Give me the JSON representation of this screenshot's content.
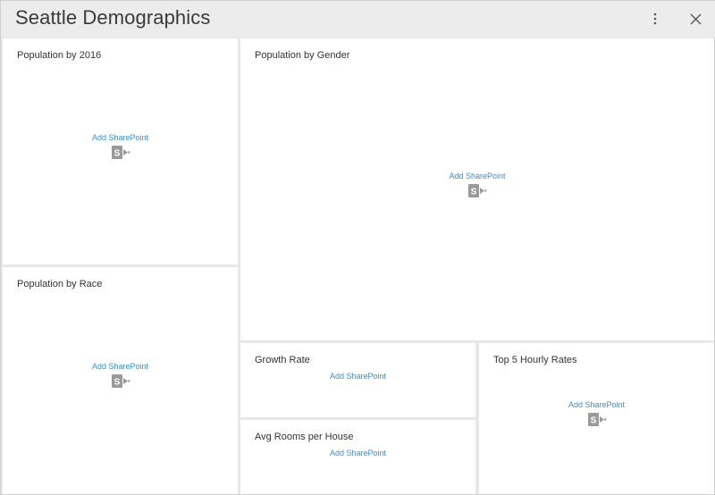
{
  "window": {
    "title": "Seattle Demographics",
    "menu_icon": "vertical-ellipsis-icon",
    "close_icon": "close-icon"
  },
  "tiles": [
    {
      "id": "population-2016",
      "title": "Population by 2016",
      "action_label": "Add SharePoint",
      "icon": "sharepoint-icon"
    },
    {
      "id": "population-race",
      "title": "Population by Race",
      "action_label": "Add SharePoint",
      "icon": "sharepoint-icon"
    },
    {
      "id": "population-gender",
      "title": "Population by Gender",
      "action_label": "Add SharePoint",
      "icon": "sharepoint-icon"
    },
    {
      "id": "growth-rate",
      "title": "Growth Rate",
      "action_label": "Add SharePoint"
    },
    {
      "id": "avg-rooms",
      "title": "Avg Rooms per House",
      "action_label": "Add SharePoint"
    },
    {
      "id": "top5-hourly",
      "title": "Top 5 Hourly Rates",
      "action_label": "Add SharePoint",
      "icon": "sharepoint-icon"
    }
  ],
  "colors": {
    "link": "#3a8fd1",
    "tile_bg": "#ffffff",
    "frame_bg": "#e8e8e8",
    "icon_gray": "#9a9a9a"
  }
}
